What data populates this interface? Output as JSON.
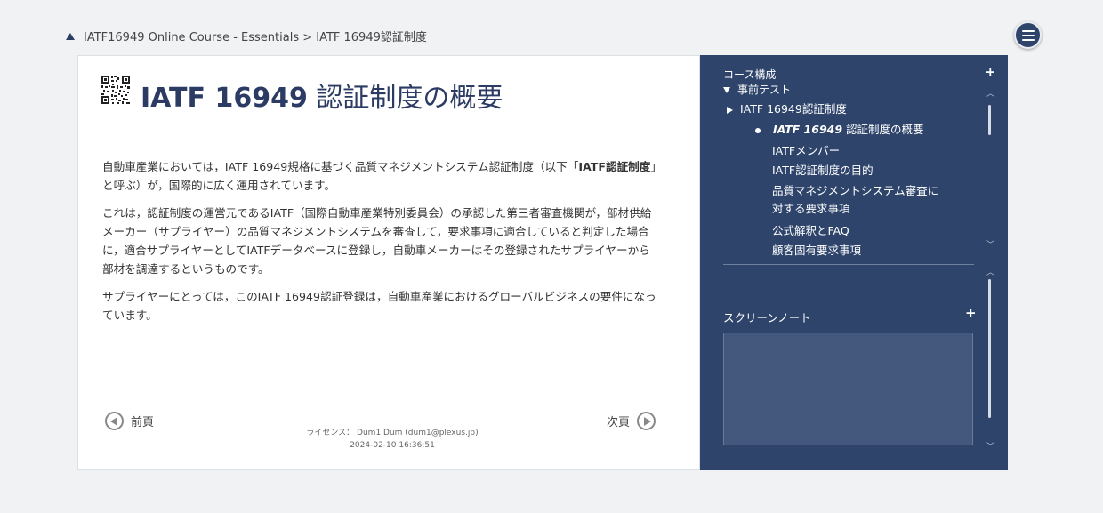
{
  "breadcrumb": {
    "text": "IATF16949 Online Course - Essentials > IATF 16949認証制度"
  },
  "page": {
    "title_bold": "IATF 16949",
    "title_rest": " 認証制度の概要"
  },
  "content": {
    "p1_a": "自動車産業においては，IATF 16949規格に基づく品質マネジメントシステム認証制度（以下「",
    "p1_bold": "IATF認証制度",
    "p1_b": "」と呼ぶ）が，国際的に広く運用されています。",
    "p2": "これは，認証制度の運営元であるIATF（国際自動車産業特別委員会）の承認した第三者審査機関が，部材供給メーカー（サプライヤー）の品質マネジメントシステムを審査して，要求事項に適合していると判定した場合に，適合サプライヤーとしてIATFデータベースに登録し，自動車メーカーはその登録されたサプライヤーから部材を調達するというものです。",
    "p3": "サプライヤーにとっては，このIATF 16949認証登録は，自動車産業におけるグローバルビジネスの要件になっています。"
  },
  "nav": {
    "prev_label": "前頁",
    "next_label": "次頁"
  },
  "license": {
    "line1": "ライセンス： Dum1 Dum (dum1@plexus.jp)",
    "line2": "2024-02-10 16:36:51"
  },
  "sidebar": {
    "course_header": "コース構成",
    "plus": "+",
    "items": [
      {
        "label": "事前テスト"
      },
      {
        "label": "IATF 16949認証制度"
      },
      {
        "label_bold": "IATF 16949",
        "label_rest": " 認証制度の概要"
      },
      {
        "label": "IATFメンバー"
      },
      {
        "label": "IATF認証制度の目的"
      },
      {
        "label_line1": "品質マネジメントシステム審査に",
        "label_line2": "対する要求事項"
      },
      {
        "label": "公式解釈とFAQ"
      },
      {
        "label": "顧客固有要求事項"
      }
    ],
    "notes_header": "スクリーンノート",
    "notes_plus": "+"
  },
  "colors": {
    "accent": "#2e446b",
    "title": "#2b3b63",
    "background": "#f1f2f4"
  }
}
